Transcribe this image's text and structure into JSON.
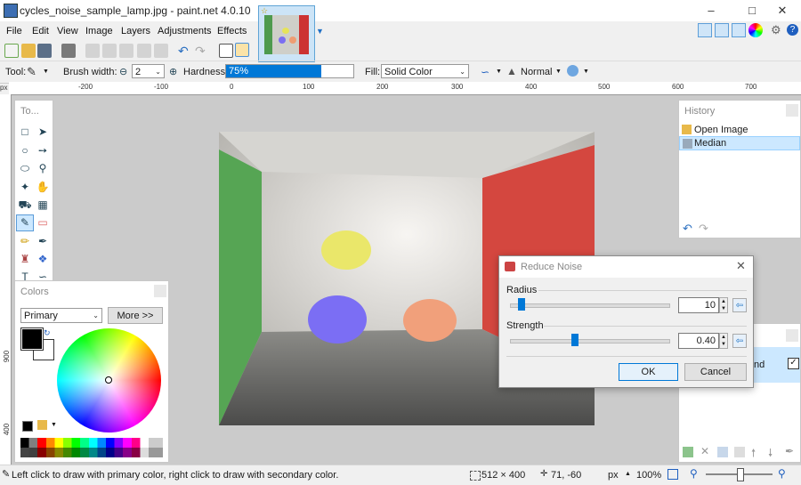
{
  "window": {
    "title": "cycles_noise_sample_lamp.jpg - paint.net 4.0.10"
  },
  "menu": [
    "File",
    "Edit",
    "View",
    "Image",
    "Layers",
    "Adjustments",
    "Effects"
  ],
  "options": {
    "tool_label": "Tool:",
    "brush_width_label": "Brush width:",
    "brush_width_value": "2",
    "hardness_label": "Hardness:",
    "hardness_value": "75%",
    "hardness_level": 0.75,
    "fill_label": "Fill:",
    "fill_value": "Solid Color",
    "blend_mode": "Normal"
  },
  "rulers": {
    "unit": "px",
    "h_ticks": [
      "-200",
      "-100",
      "0",
      "100",
      "200",
      "300",
      "400",
      "500",
      "600",
      "700"
    ],
    "v_ticks": [
      "900",
      "400"
    ]
  },
  "tools_panel": {
    "title": "To..."
  },
  "colors_panel": {
    "title": "Colors",
    "mode": "Primary",
    "more_button": "More >>"
  },
  "history_panel": {
    "title": "History",
    "items": [
      {
        "label": "Open Image",
        "selected": false
      },
      {
        "label": "Median",
        "selected": true
      }
    ]
  },
  "layers_panel": {
    "visible_text": "nd"
  },
  "dialog": {
    "title": "Reduce Noise",
    "radius_label": "Radius",
    "radius_value": "10",
    "radius_level": 0.07,
    "strength_label": "Strength",
    "strength_value": "0.40",
    "strength_level": 0.41,
    "ok": "OK",
    "cancel": "Cancel"
  },
  "status": {
    "hint": "Left click to draw with primary color, right click to draw with secondary color.",
    "image_size": "512 × 400",
    "cursor_pos": "71, -60",
    "unit": "px",
    "zoom": "100%"
  },
  "colors": {
    "accent": "#0078d7",
    "selection": "#cce8ff"
  }
}
